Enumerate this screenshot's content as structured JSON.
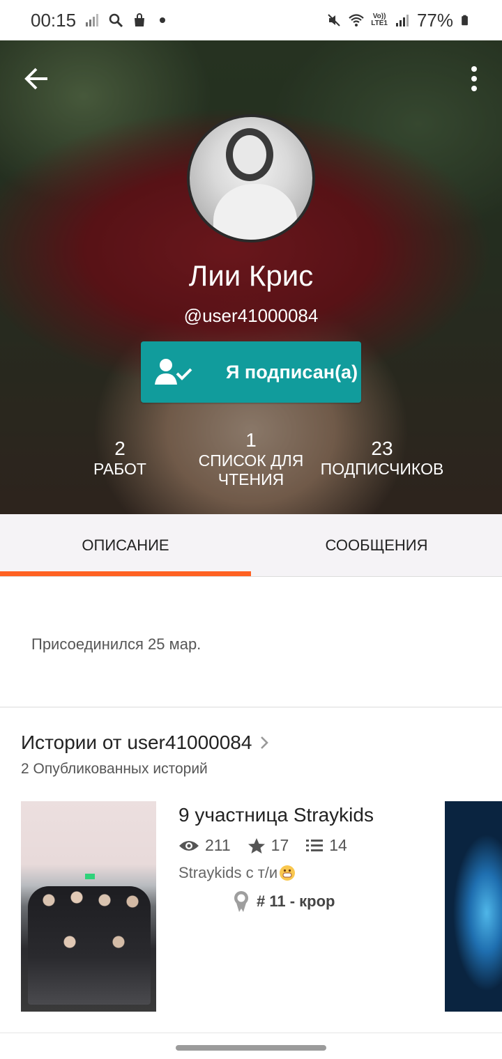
{
  "status_bar": {
    "time": "00:15",
    "battery": "77%",
    "icons": [
      "signal-icon",
      "search-icon",
      "bag-icon",
      "mute-icon",
      "wifi-icon",
      "volte-icon",
      "battery-icon"
    ],
    "volte_label": "Vo))\nLTE1"
  },
  "header": {
    "back_icon": "arrow-left-icon",
    "more_icon": "more-vert-icon"
  },
  "profile": {
    "name": "Лии Крис",
    "username": "@user41000084",
    "follow_button": "Я подписан(а)",
    "stats": [
      {
        "value": "2",
        "label": "РАБОТ"
      },
      {
        "value": "1",
        "label": "СПИСОК ДЛЯ ЧТЕНИЯ"
      },
      {
        "value": "23",
        "label": "ПОДПИСЧИКОВ"
      }
    ]
  },
  "tabs": [
    {
      "label": "ОПИСАНИЕ",
      "active": true
    },
    {
      "label": "СООБЩЕНИЯ",
      "active": false
    }
  ],
  "description": {
    "joined": "Присоединился 25 мар."
  },
  "stories": {
    "title": "Истории от user41000084",
    "count": "2 Опубликованных историй",
    "items": [
      {
        "title": "9 участница Straykids",
        "views": "211",
        "votes": "17",
        "parts": "14",
        "description": "Straykids с т/и",
        "rank": "# 11 - крор"
      }
    ]
  },
  "colors": {
    "accent": "#ff6122",
    "teal": "#119c9c"
  }
}
